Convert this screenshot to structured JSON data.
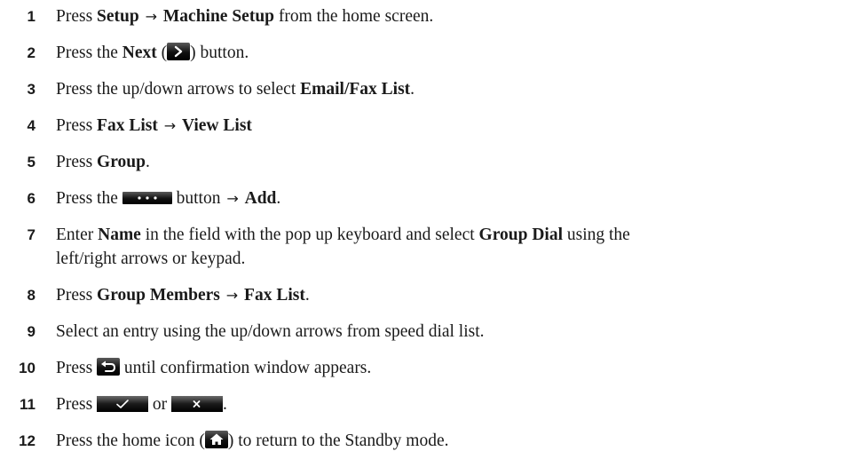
{
  "steps": [
    {
      "num": "1",
      "t1": "Press ",
      "b1": "Setup",
      "arrow": "→",
      "b2": "Machine Setup",
      "t2": " from the home screen."
    },
    {
      "num": "2",
      "t1": "Press the ",
      "b1": "Next",
      "t2": " (",
      "t3": ") button."
    },
    {
      "num": "3",
      "t1": "Press the up/down arrows to select ",
      "b1": "Email/Fax List",
      "t2": "."
    },
    {
      "num": "4",
      "t1": "Press ",
      "b1": "Fax List",
      "arrow": "→",
      "b2": "View List"
    },
    {
      "num": "5",
      "t1": "Press ",
      "b1": "Group",
      "t2": "."
    },
    {
      "num": "6",
      "t1": "Press the ",
      "t2": " button ",
      "arrow": "→",
      "b1": "Add",
      "t3": "."
    },
    {
      "num": "7",
      "t1": "Enter ",
      "b1": "Name",
      "t2": " in the field with the pop up keyboard and select ",
      "b2": "Group Dial",
      "t3": " using the",
      "line2": "left/right arrows or keypad."
    },
    {
      "num": "8",
      "t1": "Press ",
      "b1": "Group Members",
      "arrow": "→",
      "b2": "Fax List",
      "t2": "."
    },
    {
      "num": "9",
      "t1": "Select an entry using the up/down arrows from speed dial list."
    },
    {
      "num": "10",
      "t1": "Press ",
      "t2": " until confirmation window appears."
    },
    {
      "num": "11",
      "t1": "Press ",
      "t2": " or ",
      "t3": "."
    },
    {
      "num": "12",
      "t1": "Press the home icon (",
      "t2": ") to return to the Standby mode."
    }
  ],
  "icons": [
    "next-arrow-icon",
    "more-icon",
    "back-icon",
    "check-icon",
    "cancel-icon",
    "home-icon"
  ]
}
